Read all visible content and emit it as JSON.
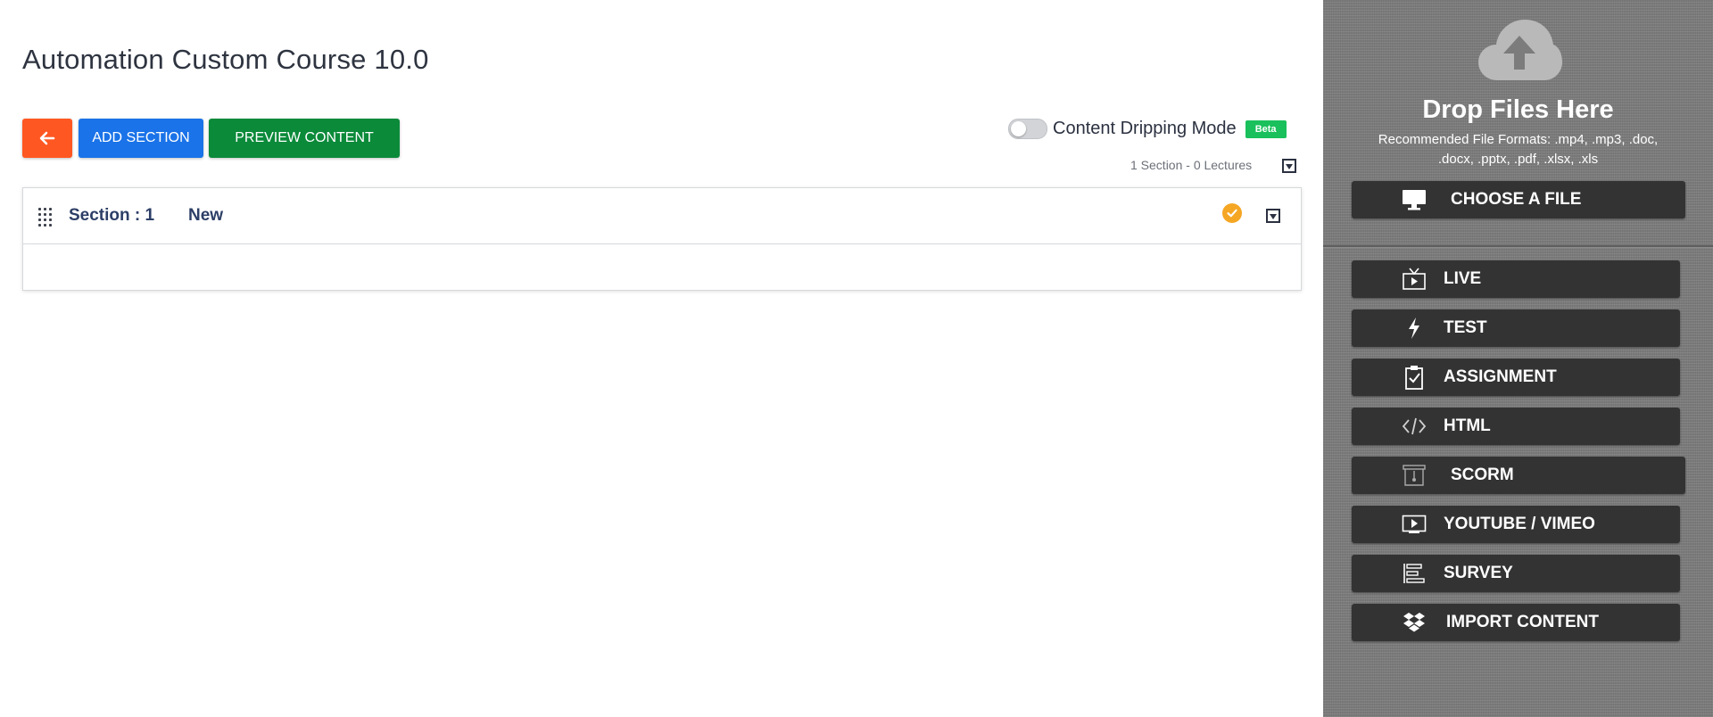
{
  "page": {
    "title": "Automation Custom Course 10.0"
  },
  "toolbar": {
    "back_icon": "arrow-left-icon",
    "add_section_label": "ADD SECTION",
    "preview_content_label": "PREVIEW CONTENT",
    "dripping_label": "Content Dripping Mode",
    "dripping_enabled": false,
    "beta_badge": "Beta",
    "summary": "1 Section - 0 Lectures"
  },
  "section": {
    "label": "Section : 1",
    "name": "New",
    "status_icon": "check-circle-icon"
  },
  "sidebar": {
    "drop_title": "Drop Files Here",
    "formats_line1": "Recommended File Formats: .mp4, .mp3, .doc,",
    "formats_line2": ".docx, .pptx, .pdf, .xlsx, .xls",
    "choose_file": {
      "label": "CHOOSE A FILE",
      "icon": "monitor-icon"
    },
    "items": [
      {
        "label": "LIVE",
        "icon": "tv-live-icon"
      },
      {
        "label": "TEST",
        "icon": "lightning-icon"
      },
      {
        "label": "ASSIGNMENT",
        "icon": "clipboard-check-icon"
      },
      {
        "label": "HTML",
        "icon": "code-icon"
      },
      {
        "label": "SCORM",
        "icon": "scorm-icon"
      },
      {
        "label": "YOUTUBE / VIMEO",
        "icon": "video-play-icon"
      },
      {
        "label": "SURVEY",
        "icon": "survey-bars-icon"
      },
      {
        "label": "IMPORT CONTENT",
        "icon": "dropbox-icon"
      }
    ]
  },
  "colors": {
    "back_button": "#ff5722",
    "add_button": "#1a73e8",
    "preview_button": "#0b8a3a",
    "beta": "#19c05b",
    "check": "#f5a623",
    "sidebar_bg": "#7c7c7c",
    "sidebar_button": "#333333"
  }
}
